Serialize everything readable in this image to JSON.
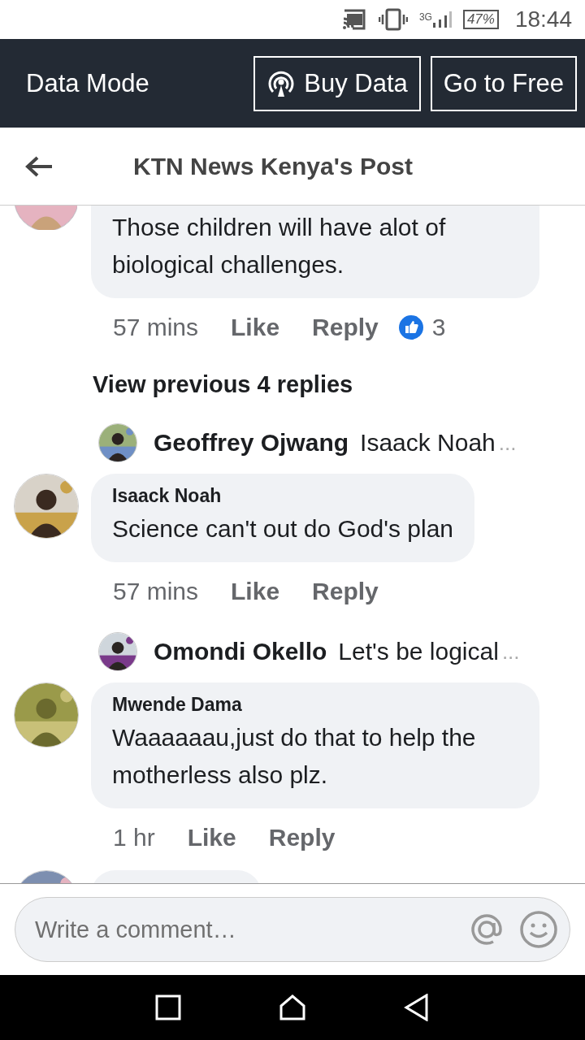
{
  "status_bar": {
    "network": "3G",
    "battery": "47%",
    "time": "18:44"
  },
  "data_bar": {
    "title": "Data Mode",
    "buttons": [
      {
        "kind": "buy",
        "label": "Buy Data"
      },
      {
        "kind": "plain",
        "label": "Go to Free"
      }
    ]
  },
  "header": {
    "title": "KTN News Kenya's Post"
  },
  "feed": [
    {
      "kind": "comment",
      "cut_off": true,
      "text": "Those children will have alot of biological challenges.",
      "time": "57 mins",
      "actions": [
        "Like",
        "Reply"
      ],
      "reactions": "3"
    },
    {
      "kind": "link",
      "label": "View previous 4 replies"
    },
    {
      "kind": "reply_preview",
      "author": "Geoffrey Ojwang",
      "text": "Isaack Noah",
      "more": "..."
    },
    {
      "kind": "comment",
      "author": "Isaack Noah",
      "text": "Science can't out do God's plan",
      "time": "57 mins",
      "actions": [
        "Like",
        "Reply"
      ]
    },
    {
      "kind": "reply_preview",
      "author": "Omondi Okello",
      "text": "Let's be logical",
      "more": "..."
    },
    {
      "kind": "comment",
      "author": "Mwende Dama",
      "text": "Waaaaaau,just do that to help the motherless also plz.",
      "time": "1 hr",
      "actions": [
        "Like",
        "Reply"
      ]
    },
    {
      "kind": "comment_stub"
    }
  ],
  "composer": {
    "placeholder": "Write a comment…"
  }
}
